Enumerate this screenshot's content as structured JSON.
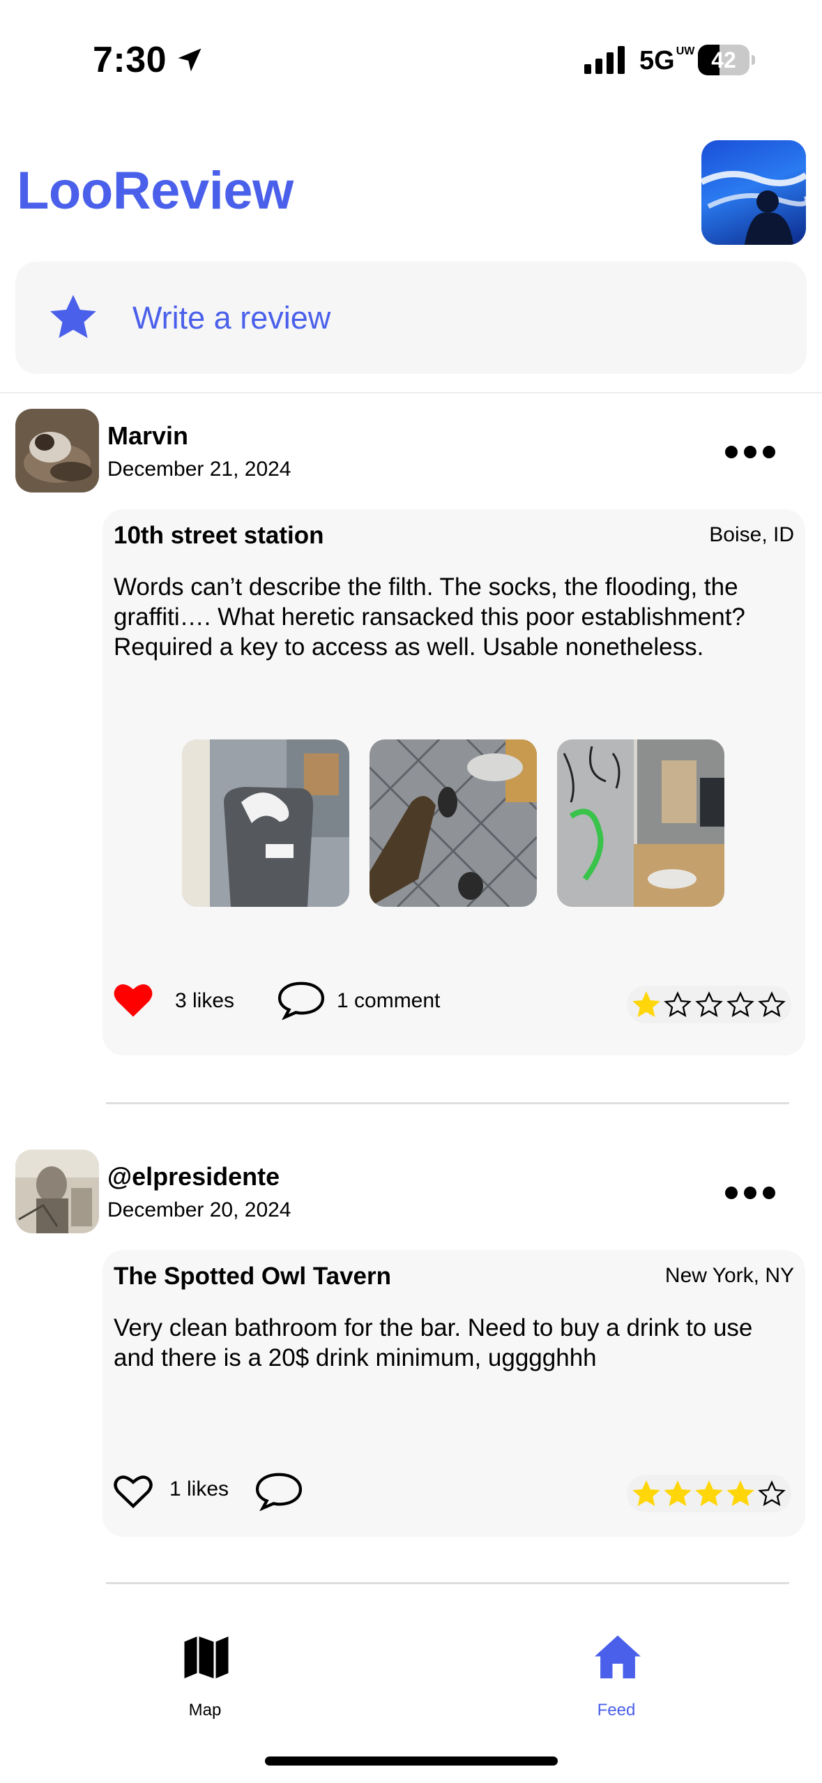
{
  "status_bar": {
    "time": "7:30",
    "network": "5G",
    "network_suffix": "UW",
    "battery_level": "42",
    "battery_fraction": 0.42
  },
  "header": {
    "title": "LooReview",
    "write_review_label": "Write a review",
    "accent_color": "#4a60ea"
  },
  "posts": [
    {
      "user": "Marvin",
      "date": "December 21, 2024",
      "place": "10th street station",
      "city": "Boise, ID",
      "body": "Words can’t describe the filth. The socks, the flooding, the graffiti…. What heretic ransacked this poor establishment? Required a key to access as well. Usable nonetheless.",
      "photo_count": 3,
      "liked": true,
      "likes_text": "3 likes",
      "comments_text": "1 comment",
      "rating": 1,
      "rating_max": 5
    },
    {
      "user": "@elpresidente",
      "date": "December 20, 2024",
      "place": "The Spotted Owl Tavern",
      "city": "New York, NY",
      "body": "Very clean bathroom for the bar. Need to buy a drink to use and there is a 20$ drink minimum, ugggghhh",
      "photo_count": 0,
      "liked": false,
      "likes_text": "1 likes",
      "comments_text": "",
      "rating": 4,
      "rating_max": 5
    }
  ],
  "tab_bar": {
    "tabs": [
      {
        "label": "Map",
        "icon": "map-icon",
        "active": false
      },
      {
        "label": "Feed",
        "icon": "house-icon",
        "active": true
      }
    ],
    "active_color": "#4a60ea",
    "inactive_color": "#000000"
  },
  "icons": {
    "heart_filled_color": "#ff0000",
    "star_filled_color": "#ffd60a"
  }
}
